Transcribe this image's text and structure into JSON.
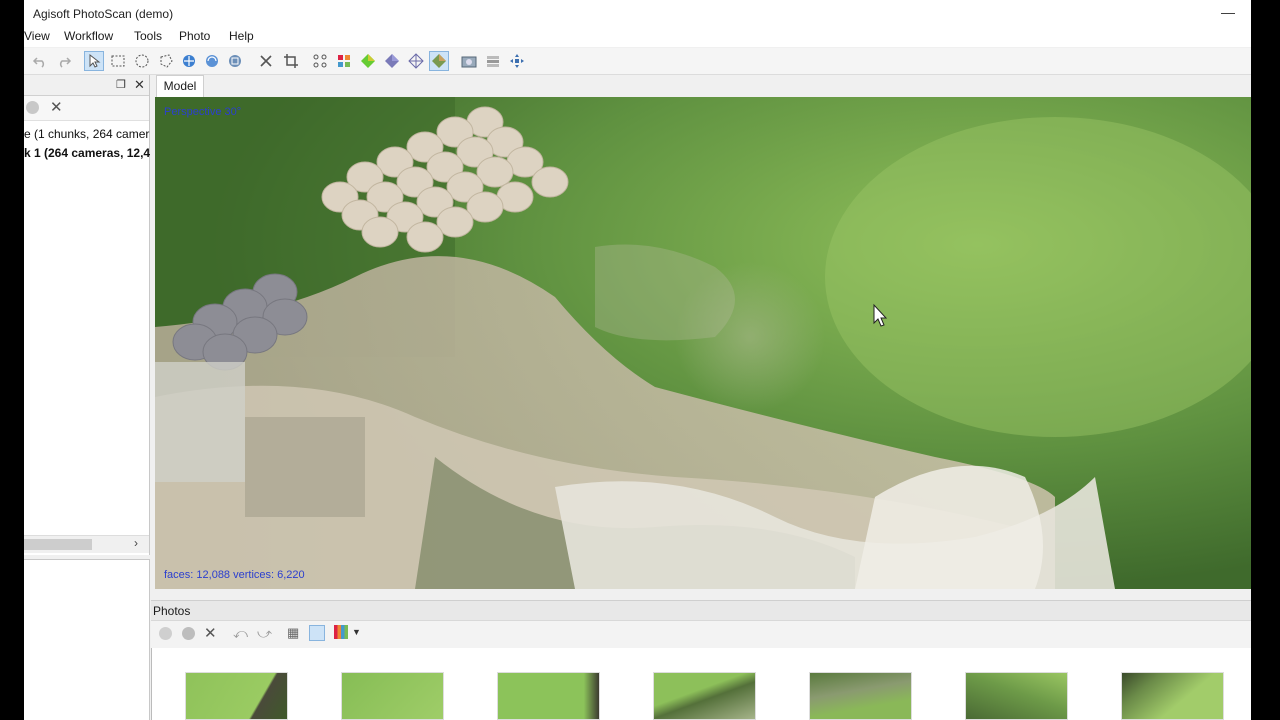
{
  "window": {
    "title": "Agisoft PhotoScan (demo)"
  },
  "menu": [
    "View",
    "Workflow",
    "Tools",
    "Photo",
    "Help"
  ],
  "toolbar": {
    "buttons": [
      "undo-icon",
      "redo-icon",
      "select-icon",
      "rect-select-icon",
      "circle-select-icon",
      "free-select-icon",
      "move-object-icon",
      "rotate-object-icon",
      "scale-object-icon",
      "delete-icon",
      "crop-icon",
      "point-cloud-icon",
      "dense-cloud-icon",
      "solid-model-icon",
      "shaded-model-icon",
      "wireframe-icon",
      "textured-model-icon",
      "camera-icon",
      "camera-shows-icon",
      "navigation-icon"
    ]
  },
  "workspace": {
    "row1": "e (1 chunks, 264 camer",
    "row2": "k 1 (264 cameras, 12,4"
  },
  "model": {
    "tab_label": "Model",
    "projection_label": "Perspective 30°",
    "stats_label": "faces: 12,088 vertices: 6,220"
  },
  "photos": {
    "title": "Photos",
    "thumbnails": [
      "thumb-1",
      "thumb-2",
      "thumb-3",
      "thumb-4",
      "thumb-5",
      "thumb-6",
      "thumb-7"
    ]
  },
  "colors": {
    "accent_text": "#2b3fcf",
    "active_tool": "#cde3f7",
    "terrain_green": "#4f7a33"
  }
}
